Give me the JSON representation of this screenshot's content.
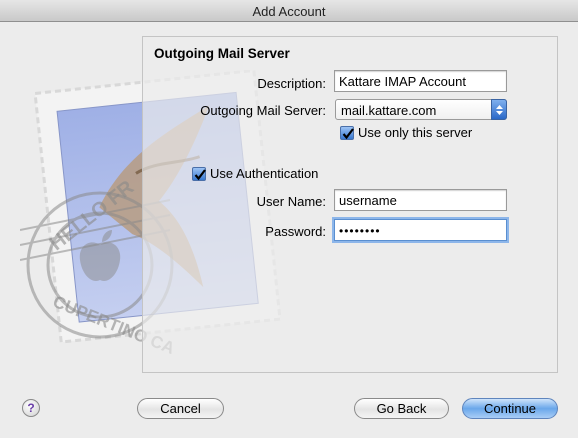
{
  "window": {
    "title": "Add Account"
  },
  "section": {
    "title": "Outgoing Mail Server"
  },
  "form": {
    "description_label": "Description:",
    "description_value": "Kattare IMAP Account",
    "server_label": "Outgoing Mail Server:",
    "server_value": "mail.kattare.com",
    "use_only_label": "Use only this server",
    "use_only_checked": true,
    "use_auth_label": "Use Authentication",
    "use_auth_checked": true,
    "username_label": "User Name:",
    "username_value": "username",
    "password_label": "Password:",
    "password_value": "••••••••"
  },
  "buttons": {
    "help": "?",
    "cancel": "Cancel",
    "go_back": "Go Back",
    "continue": "Continue"
  },
  "art": {
    "postmark_text_1": "HELLO FR",
    "postmark_text_2": "CUPERTINO CA"
  },
  "colors": {
    "accent": "#3878d0",
    "focus_ring": "#8db6ea"
  }
}
